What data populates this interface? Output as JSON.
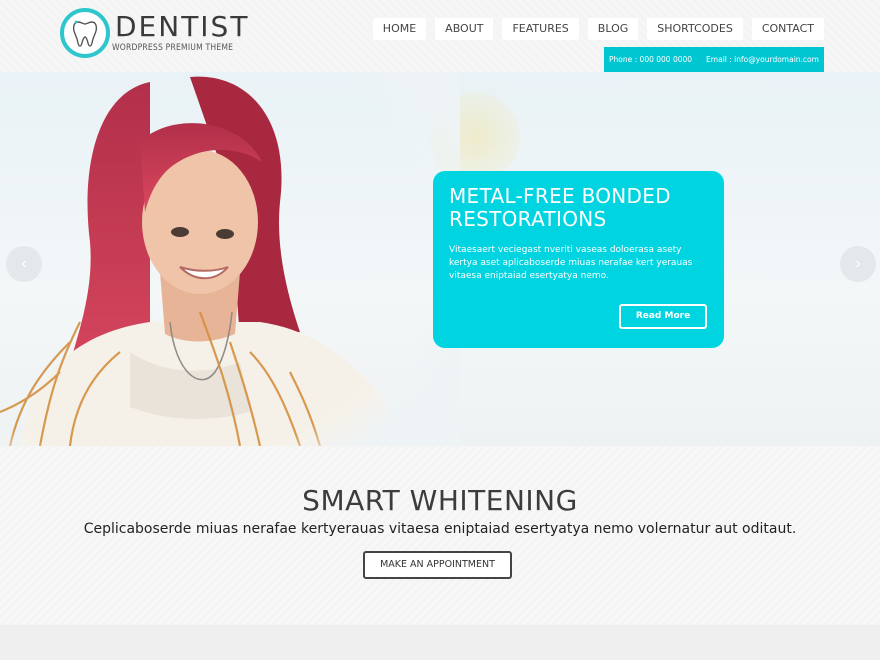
{
  "logo": {
    "title": "DENTIST",
    "subtitle": "WORDPRESS PREMIUM THEME"
  },
  "nav": {
    "items": [
      {
        "label": "HOME"
      },
      {
        "label": "ABOUT"
      },
      {
        "label": "FEATURES"
      },
      {
        "label": "BLOG"
      },
      {
        "label": "SHORTCODES"
      },
      {
        "label": "CONTACT"
      }
    ]
  },
  "contact": {
    "phone": "Phone : 000 000 0000",
    "email": "Email : info@yourdomain.com"
  },
  "slider": {
    "title": "METAL-FREE BONDED RESTORATIONS",
    "text": "Vitaesaert veciegast nveriti vaseas doloerasa asety kertya aset aplicaboserde miuas nerafae kert yerauas vitaesa eniptaiad esertyatya nemo.",
    "button": "Read More",
    "prev_icon": "chevron-left-icon",
    "next_icon": "chevron-right-icon"
  },
  "section": {
    "title": "SMART WHITENING",
    "text": "Ceplicaboserde miuas nerafae kertyerauas vitaesa eniptaiad esertyatya nemo volernatur aut oditaut.",
    "button": "MAKE AN APPOINTMENT"
  },
  "colors": {
    "accent": "#00d4e0",
    "logo_ring": "#2ec6cd",
    "contact_bar": "#00c6d2"
  }
}
